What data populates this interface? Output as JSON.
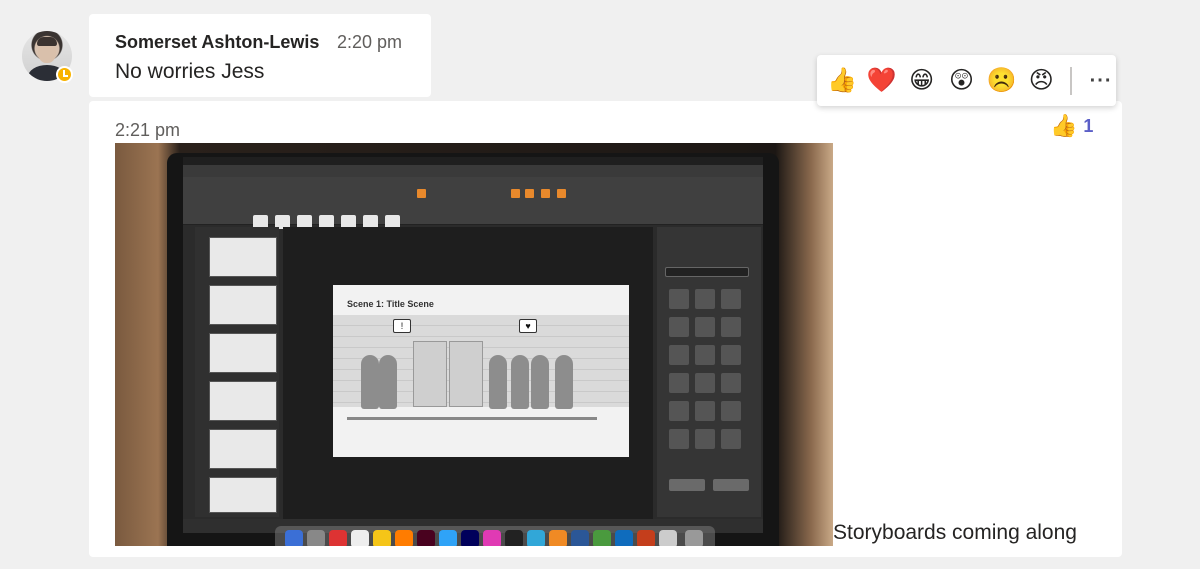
{
  "message1": {
    "author": "Somerset Ashton-Lewis",
    "time": "2:20 pm",
    "text": "No worries Jess",
    "presence": "away"
  },
  "message2": {
    "time": "2:21 pm",
    "caption": "Storyboards coming along",
    "reaction": {
      "emoji": "👍",
      "count": "1"
    },
    "photo": {
      "description_icon": "laptop-screen-photo",
      "slide_title": "Scene 1: Title Scene"
    }
  },
  "reaction_bar": {
    "options": [
      {
        "name": "like",
        "emoji": "👍"
      },
      {
        "name": "heart",
        "emoji": "❤️"
      },
      {
        "name": "laugh",
        "emoji": "😁"
      },
      {
        "name": "surprised",
        "emoji": "😲"
      },
      {
        "name": "sad",
        "emoji": "☹️"
      },
      {
        "name": "angry",
        "emoji": "😠"
      }
    ],
    "more_label": "···"
  },
  "colors": {
    "background": "#f0f0f0",
    "card": "#ffffff",
    "accent": "#5b5fc7",
    "away": "#f8b300"
  }
}
